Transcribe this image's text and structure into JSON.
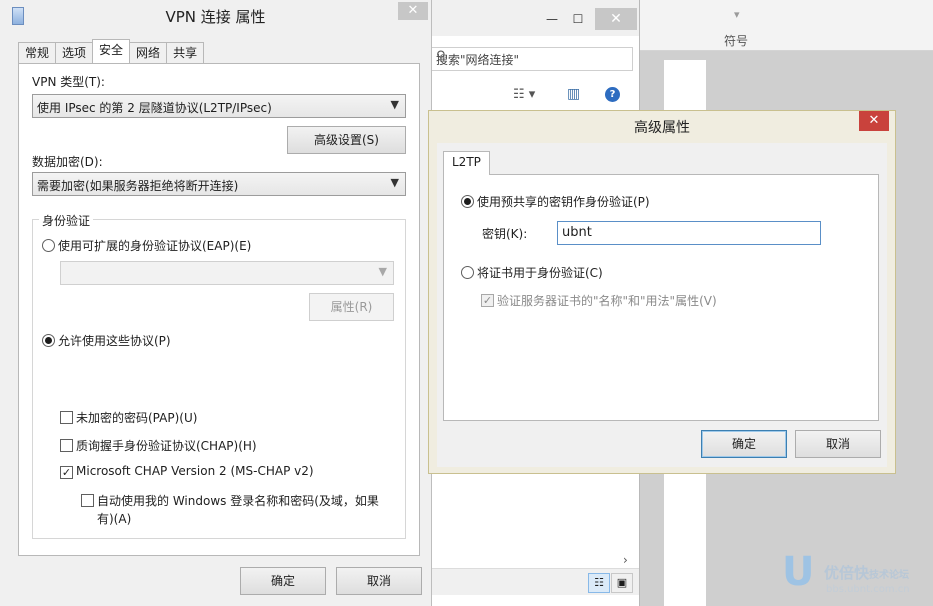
{
  "background": {
    "ribbon_group_label": "符号",
    "explorer_search_placeholder": "搜索\"网络连接\""
  },
  "vpn_dialog": {
    "title": "VPN 连接 属性",
    "tabs": [
      "常规",
      "选项",
      "安全",
      "网络",
      "共享"
    ],
    "active_tab": "安全",
    "vpn_type_label": "VPN 类型(T):",
    "vpn_type_value": "使用 IPsec 的第 2 层隧道协议(L2TP/IPsec)",
    "advanced_button": "高级设置(S)",
    "encryption_label": "数据加密(D):",
    "encryption_value": "需要加密(如果服务器拒绝将断开连接)",
    "auth_group_label": "身份验证",
    "eap_radio_label": "使用可扩展的身份验证协议(EAP)(E)",
    "eap_properties_button": "属性(R)",
    "allow_protocols_label": "允许使用这些协议(P)",
    "pap_label": "未加密的密码(PAP)(U)",
    "chap_label": "质询握手身份验证协议(CHAP)(H)",
    "mschap_label": "Microsoft CHAP Version 2 (MS-CHAP v2)",
    "auto_login_line1": "自动使用我的 Windows 登录名称和密码(及域，如果",
    "auto_login_line2": "有)(A)",
    "ok_button": "确定",
    "cancel_button": "取消"
  },
  "advanced_dialog": {
    "title": "高级属性",
    "tab": "L2TP",
    "psk_radio_label": "使用预共享的密钥作身份验证(P)",
    "key_label": "密钥(K):",
    "key_value": "ubnt",
    "cert_radio_label": "将证书用于身份验证(C)",
    "verify_cert_label": "验证服务器证书的\"名称\"和\"用法\"属性(V)",
    "ok_button": "确定",
    "cancel_button": "取消"
  },
  "watermark": {
    "logo": "U",
    "name": "优倍快",
    "tagline": "技术论坛",
    "url": "bbs.ubnt.com.cn"
  },
  "states": {
    "eap_selected": false,
    "allow_protocols_selected": true,
    "pap_checked": false,
    "chap_checked": false,
    "mschap_checked": true,
    "auto_login_checked": false,
    "psk_selected": true,
    "cert_selected": false,
    "verify_cert_checked": true
  }
}
